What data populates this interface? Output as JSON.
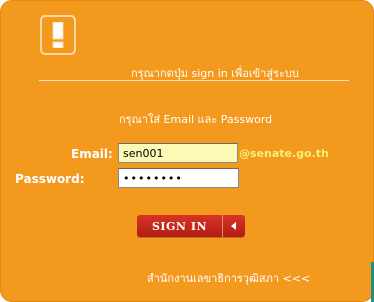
{
  "header": {
    "icon": "exclamation-warning-icon",
    "prompt": "กรุณากดปุ่ม sign in เพื่อเข้าสู่ระบบ"
  },
  "form": {
    "instruction": "กรุณาใส่ Email และ Password",
    "email_label": "Email:",
    "email_value": "sen001",
    "email_domain": "@senate.go.th",
    "password_label": "Password:",
    "password_value": "••••••••",
    "signin_label": "SIGN IN",
    "signin_caret_icon": "caret-left-icon"
  },
  "footer": {
    "link": "สำนักงานเลขาธิการวุฒิสภา <<<"
  },
  "colors": {
    "panel": "#f39a1e",
    "button": "#c8281c",
    "domain_text": "#fbef74",
    "email_field_bg": "#fbfab6"
  }
}
